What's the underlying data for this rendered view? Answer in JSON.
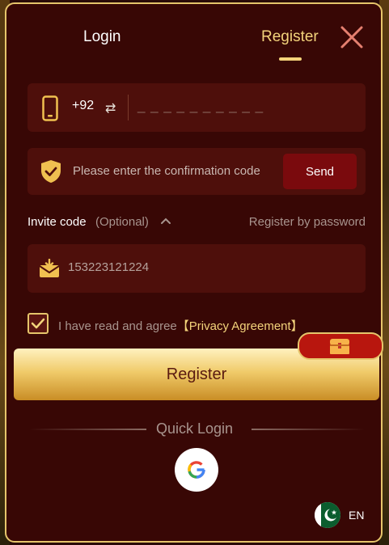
{
  "tabs": {
    "login": "Login",
    "register": "Register",
    "active": "register"
  },
  "phone": {
    "country_code": "+92",
    "placeholder": "_ _ _ _ _ _ _ _ _ _"
  },
  "verification": {
    "placeholder": "Please enter the confirmation code",
    "send_label": "Send"
  },
  "invite": {
    "label": "Invite code",
    "optional_label": "(Optional)",
    "value": "153223121224",
    "alt_link": "Register by password"
  },
  "agreement": {
    "text": "I have read and agree",
    "link": "【Privacy Agreement】",
    "checked": true
  },
  "register_button": "Register",
  "quick_login": {
    "label": "Quick Login",
    "providers": [
      "google-icon"
    ]
  },
  "language": {
    "code": "EN",
    "flag": "pakistan-flag-icon"
  },
  "colors": {
    "accent": "#f3d37b",
    "panel": "#380705",
    "field": "#4e0f0b",
    "send": "#7a0a0d"
  }
}
